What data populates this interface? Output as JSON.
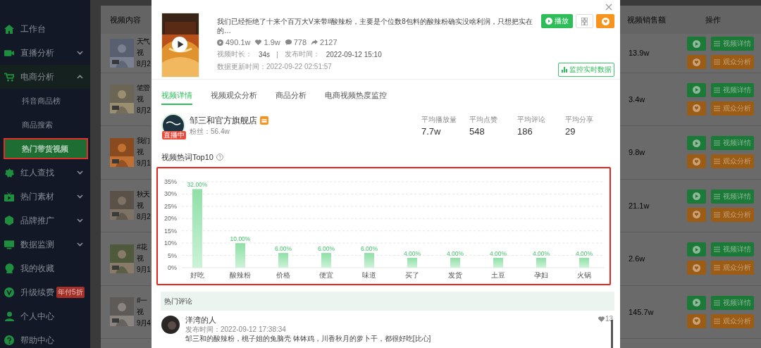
{
  "sidebar": {
    "items": [
      {
        "label": "工作台",
        "kind": "link"
      },
      {
        "label": "直播分析",
        "kind": "group",
        "expanded": false
      },
      {
        "label": "电商分析",
        "kind": "group",
        "expanded": true,
        "children": [
          {
            "label": "抖音商品榜",
            "selected": false,
            "annotated": false
          },
          {
            "label": "商品搜索",
            "selected": false,
            "annotated": false
          },
          {
            "label": "热门带货视频",
            "selected": true,
            "annotated": true
          }
        ]
      },
      {
        "label": "红人查找",
        "kind": "group",
        "expanded": false
      },
      {
        "label": "热门素材",
        "kind": "group",
        "expanded": false
      },
      {
        "label": "品牌推广",
        "kind": "group",
        "expanded": false
      },
      {
        "label": "数据监测",
        "kind": "group",
        "expanded": false
      },
      {
        "label": "我的收藏",
        "kind": "link"
      },
      {
        "label": "升级续费",
        "kind": "link",
        "badge": "年付5折"
      },
      {
        "label": "个人中心",
        "kind": "link"
      },
      {
        "label": "帮助中心",
        "kind": "link"
      }
    ]
  },
  "table": {
    "columns": [
      "视频内容",
      "视频销售额",
      "操作"
    ],
    "rows": [
      {
        "title": "天气",
        "line_2": "视",
        "date": "8月2",
        "sales": "13.9w",
        "actions": [
          "视频详情",
          "观众分析"
        ]
      },
      {
        "title": "笔管",
        "line_2": "视",
        "date": "8月2",
        "sales": "3.4w",
        "actions": [
          "视频详情",
          "观众分析"
        ]
      },
      {
        "title": "我们",
        "line_2": "视",
        "date": "9月1",
        "sales": "9.8w",
        "actions": [
          "视频详情",
          "观众分析"
        ]
      },
      {
        "title": "秋天",
        "line_2": "视",
        "date": "8月2",
        "sales": "21.1w",
        "actions": [
          "视频详情",
          "观众分析"
        ]
      },
      {
        "title": "#花",
        "line_2": "视",
        "date": "9月1",
        "sales": "2.6w",
        "actions": [
          "视频详情",
          "观众分析"
        ]
      },
      {
        "title": "#一",
        "line_2": "视",
        "date": "9月4",
        "sales": "145.7w",
        "actions": [
          "视频详情",
          "观众分析"
        ]
      }
    ]
  },
  "modal": {
    "description": "我们已经拒绝了十来个百万大V来带#酸辣粉，主要是个位数8包料的酸辣粉确实没啥利润，只想把实在的…",
    "stats": {
      "plays": "490.1w",
      "likes": "1.9w",
      "comments": "778",
      "shares": "2127"
    },
    "duration_label": "视频时长：",
    "duration": "34s",
    "separator": "|",
    "publish_label": "发布时间：",
    "publish_time": "2022-09-12 15:10",
    "updated_label": "数据更新时间：",
    "updated_time": "2022-09-22 02:51:57",
    "play_button": "播放",
    "monitor_button": "监控实时数据",
    "tabs": [
      {
        "label": "视频详情",
        "selected": true
      },
      {
        "label": "视频观众分析",
        "selected": false
      },
      {
        "label": "商品分析",
        "selected": false
      },
      {
        "label": "电商视频热度监控",
        "selected": false
      }
    ],
    "shop": {
      "name": "邹三和官方旗舰店",
      "live_badge": "直播中",
      "fans": "粉丝：56.4w"
    },
    "averages": [
      {
        "label": "平均播放量",
        "value": "7.7w"
      },
      {
        "label": "平均点赞",
        "value": "548"
      },
      {
        "label": "平均评论",
        "value": "186"
      },
      {
        "label": "平均分享",
        "value": "29"
      }
    ],
    "hot_words": {
      "title": "视频热词Top10",
      "annotated": true,
      "chart_data": {
        "type": "bar",
        "categories": [
          "好吃",
          "酸辣粉",
          "价格",
          "便宜",
          "味道",
          "买了",
          "发货",
          "土豆",
          "孕妇",
          "火锅"
        ],
        "values": [
          32,
          10,
          6,
          6,
          6,
          4,
          4,
          4,
          4,
          4
        ],
        "grid": true,
        "value_labels": [
          "32.00%",
          "10.00%",
          "6.00%",
          "6.00%",
          "6.00%",
          "4.00%",
          "4.00%",
          "4.00%",
          "4.00%",
          "4.00%"
        ],
        "ylim": [
          0,
          35
        ],
        "yticks": [
          {
            "value": 0,
            "label": "0%"
          },
          {
            "value": 5,
            "label": "5%"
          },
          {
            "value": 10,
            "label": "10%"
          },
          {
            "value": 15,
            "label": "15%"
          },
          {
            "value": 20,
            "label": "20%"
          },
          {
            "value": 25,
            "label": "25%"
          },
          {
            "value": 30,
            "label": "30%"
          },
          {
            "value": 35,
            "label": "35%"
          }
        ]
      }
    },
    "comments": {
      "title": "热门评论",
      "items": [
        {
          "user": "洋湾的人",
          "time": "发布时间：2022-09-12 17:38:34",
          "text": "邹三和的酸辣粉，桃子姐的兔脑壳 钵钵鸡，川香秋月的萝卜干，都很好吃[比心]",
          "likes": "13"
        }
      ]
    }
  }
}
